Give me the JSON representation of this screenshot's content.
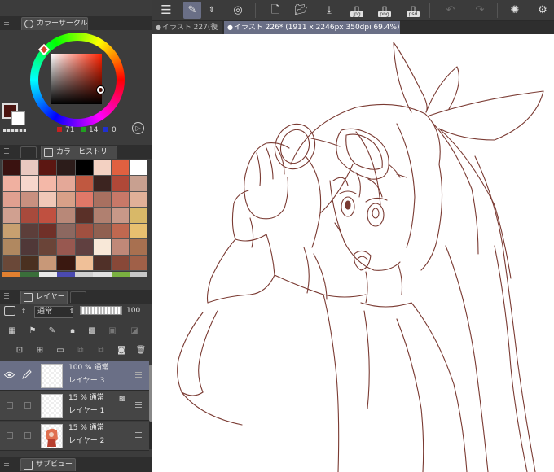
{
  "toolbar": {
    "icons": [
      "menu-icon",
      "layer-move-icon",
      "updown-icon",
      "rotate-icon",
      "new-canvas-icon",
      "open-folder-icon",
      "save-icon",
      "export-jpg-icon",
      "export-png-icon",
      "export-psd-icon",
      "undo-icon",
      "redo-icon",
      "loading-icon",
      "settings-icon"
    ],
    "jpg_label": "jpg",
    "png_label": "png",
    "psd_label": "psd"
  },
  "doc_tabs": [
    {
      "label": "イラスト 227(復",
      "active": false
    },
    {
      "label": "イラスト 226* (1911 x 2246px 350dpi 69.4%)",
      "active": true
    }
  ],
  "color_circle": {
    "tab_label": "カラーサークル",
    "main_color": "#4a1410",
    "sub_color": "#ffffff",
    "r": "71",
    "g": "14",
    "b": "0"
  },
  "color_history": {
    "tab_label": "カラーヒストリー",
    "swatches": [
      "#3a1210",
      "#e8c8c0",
      "#5c1712",
      "#2c1c1a",
      "#000000",
      "#f3d1c2",
      "#e06040",
      "#ffffff",
      "#f0b0a0",
      "#f6d6cc",
      "#f4b8a8",
      "#e4a898",
      "#c05840",
      "#3c2420",
      "#b04838",
      "#c8a090",
      "#e0a090",
      "#c89080",
      "#f0c8b8",
      "#d8a088",
      "#e07868",
      "#a87060",
      "#c87868",
      "#e0b098",
      "#d0a090",
      "#a84a3c",
      "#c05040",
      "#b88878",
      "#5a3028",
      "#b08070",
      "#c89888",
      "#d8b868",
      "#c8a070",
      "#5c3e3a",
      "#703028",
      "#8c6860",
      "#a05040",
      "#906050",
      "#c06850",
      "#e8c070",
      "#b08860",
      "#503838",
      "#6a4438",
      "#985850",
      "#604040",
      "#f8e8d8",
      "#c08878",
      "#a87050",
      "#6a4838",
      "#4a3020",
      "#c89878",
      "#3a1810",
      "#f0c098",
      "#503028",
      "#884838",
      "#a06048"
    ],
    "strip": [
      "#e08030",
      "#3a6e3a",
      "#e8e8e8",
      "#4a4ab0",
      "#d0d0d0",
      "#e0e0e0",
      "#7ab040",
      "#c8c8c8"
    ]
  },
  "layers_panel": {
    "tab_label": "レイヤー",
    "blend_mode": "通常",
    "opacity": "100",
    "layers": [
      {
        "line1": "100 % 通常",
        "line2": "レイヤー 3",
        "active": true,
        "visible": true
      },
      {
        "line1": "15 % 通常",
        "line2": "レイヤー 1",
        "active": false,
        "visible": false
      },
      {
        "line1": "15 % 通常",
        "line2": "レイヤー 2",
        "active": false,
        "visible": false
      }
    ]
  },
  "sub_view": {
    "tab_label": "サブビュー"
  },
  "colors": {
    "accent": "#6a6f86",
    "line_art": "#7a3a32"
  }
}
